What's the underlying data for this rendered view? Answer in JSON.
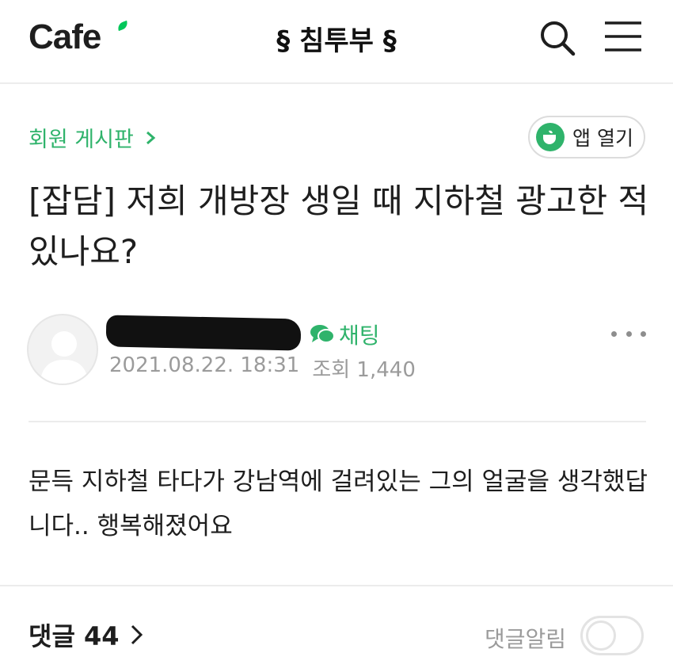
{
  "header": {
    "logo": "Cafe",
    "cafe_name": "§ 침투부 §"
  },
  "board": {
    "name": "회원 게시판",
    "app_open_label": "앱 열기"
  },
  "post": {
    "title": "[잡담] 저희 개방장 생일 때 지하철 광고한 적 있나요?",
    "author": "",
    "chat_label": "채팅",
    "date": "2021.08.22. 18:31",
    "views_label": "조회 1,440",
    "body": "문득 지하철 타다가 강남역에 걸려있는 그의 얼굴을 생각했답니다.. 행복해졌어요"
  },
  "footer": {
    "comments_label": "댓글 44",
    "notify_label": "댓글알림",
    "notify_on": false
  },
  "colors": {
    "accent": "#2fb36b",
    "brand_leaf": "#03c75a",
    "muted": "#9b9b9b"
  },
  "icons": [
    "search-icon",
    "menu-icon",
    "chevron-right-icon",
    "cafe-app-icon",
    "chat-bubble-icon",
    "more-dots-icon",
    "avatar-placeholder-icon"
  ]
}
